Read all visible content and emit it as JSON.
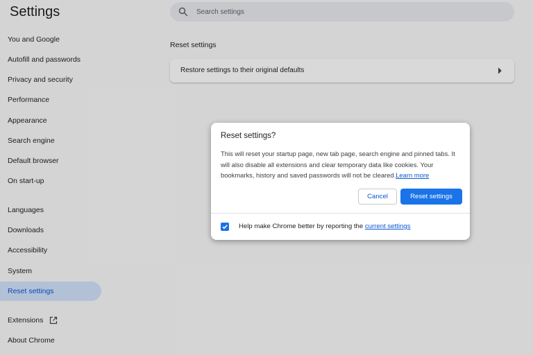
{
  "app": {
    "title": "Settings"
  },
  "search": {
    "placeholder": "Search settings"
  },
  "sidebar": {
    "items": [
      {
        "label": "You and Google"
      },
      {
        "label": "Autofill and passwords"
      },
      {
        "label": "Privacy and security"
      },
      {
        "label": "Performance"
      },
      {
        "label": "Appearance"
      },
      {
        "label": "Search engine"
      },
      {
        "label": "Default browser"
      },
      {
        "label": "On start-up"
      },
      {
        "label": "Languages"
      },
      {
        "label": "Downloads"
      },
      {
        "label": "Accessibility"
      },
      {
        "label": "System"
      },
      {
        "label": "Reset settings",
        "active": true
      },
      {
        "label": "Extensions",
        "icon": "external-link-icon"
      },
      {
        "label": "About Chrome"
      }
    ]
  },
  "main": {
    "section_title": "Reset settings",
    "card": {
      "label": "Restore settings to their original defaults",
      "icon": "chevron-right-icon"
    }
  },
  "dialog": {
    "title": "Reset settings?",
    "body": "This will reset your startup page, new tab page, search engine and pinned tabs. It will also disable all extensions and clear temporary data like cookies. Your bookmarks, history and saved passwords will not be cleared.",
    "learn_more": "Learn more",
    "cancel_label": "Cancel",
    "reset_label": "Reset settings",
    "checkbox": {
      "checked": true,
      "text": "Help make Chrome better by reporting the ",
      "link": "current settings"
    }
  },
  "colors": {
    "accent": "#1a73e8",
    "link": "#0b57d0",
    "active_nav_bg": "#d3e3fd"
  }
}
